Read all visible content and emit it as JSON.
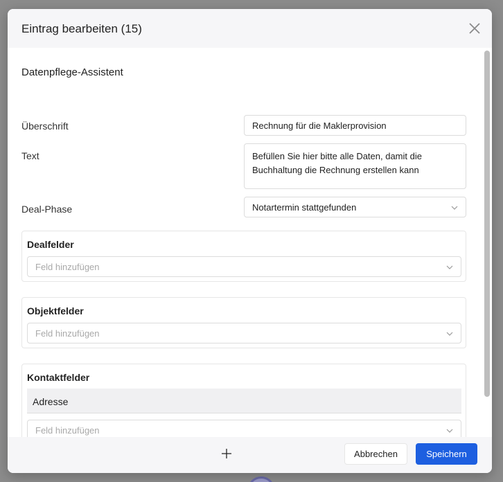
{
  "modal": {
    "title": "Eintrag bearbeiten (15)",
    "section_title": "Datenpflege-Assistent"
  },
  "form": {
    "heading_label": "Überschrift",
    "heading_value": "Rechnung für die Maklerprovision",
    "text_label": "Text",
    "text_line1": "Befüllen Sie hier bitte alle Daten, damit die",
    "text_line2": "Buchhaltung die Rechnung erstellen kann",
    "phase_label": "Deal-Phase",
    "phase_value": "Notartermin stattgefunden"
  },
  "groups": {
    "deal": {
      "title": "Dealfelder",
      "placeholder": "Feld hinzufügen"
    },
    "object": {
      "title": "Objektfelder",
      "placeholder": "Feld hinzufügen"
    },
    "contact": {
      "title": "Kontaktfelder",
      "field": "Adresse",
      "placeholder": "Feld hinzufügen"
    }
  },
  "footer": {
    "cancel_label": "Abbrechen",
    "save_label": "Speichern"
  },
  "colors": {
    "primary": "#1d5fe0"
  },
  "icons": {
    "close": "close-icon",
    "chevron": "chevron-down-icon",
    "plus": "plus-icon"
  }
}
